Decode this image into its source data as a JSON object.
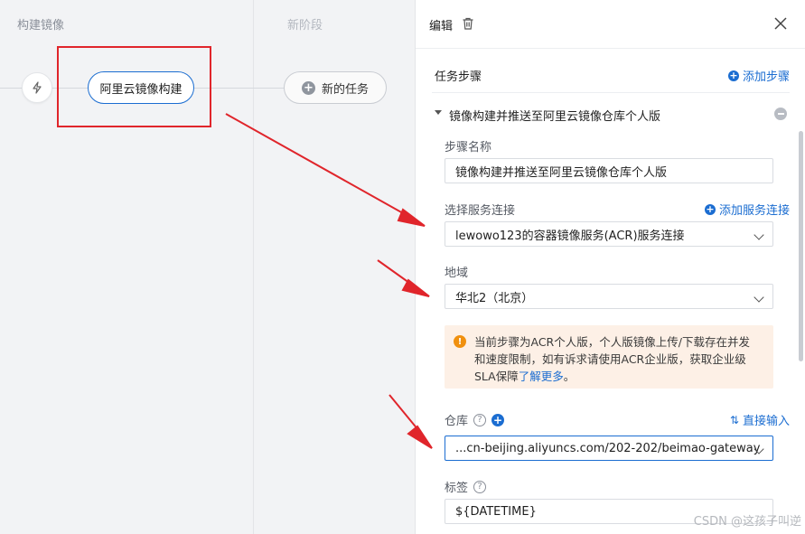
{
  "pipeline": {
    "stages": [
      {
        "title": "构建镜像"
      },
      {
        "title": "新阶段"
      }
    ],
    "task_label": "阿里云镜像构建",
    "new_task_label": "新的任务",
    "trigger_icon": "lightning-icon"
  },
  "panel": {
    "title": "编辑",
    "section_title": "任务步骤",
    "add_step_label": "添加步骤",
    "step_title": "镜像构建并推送至阿里云镜像仓库个人版",
    "step_name_label": "步骤名称",
    "step_name_value": "镜像构建并推送至阿里云镜像仓库个人版",
    "service_label": "选择服务连接",
    "add_service_label": "添加服务连接",
    "service_value": "lewowo123的容器镜像服务(ACR)服务连接",
    "region_label": "地域",
    "region_value": "华北2（北京）",
    "alert_text": "当前步骤为ACR个人版，个人版镜像上传/下载存在并发和速度限制，如有诉求请使用ACR企业版，获取企业级SLA保障",
    "alert_link": "了解更多",
    "alert_end": "。",
    "repo_label": "仓库",
    "repo_switch_label": "直接输入",
    "repo_value": "...cn-beijing.aliyuncs.com/202-202/beimao-gateway",
    "tag_label": "标签",
    "tag_value": "${DATETIME}"
  },
  "watermark": "CSDN @这孩子叫逆",
  "colors": {
    "accent": "#1b6dd1",
    "annotation": "#e0252b",
    "warning": "#f0900f"
  }
}
